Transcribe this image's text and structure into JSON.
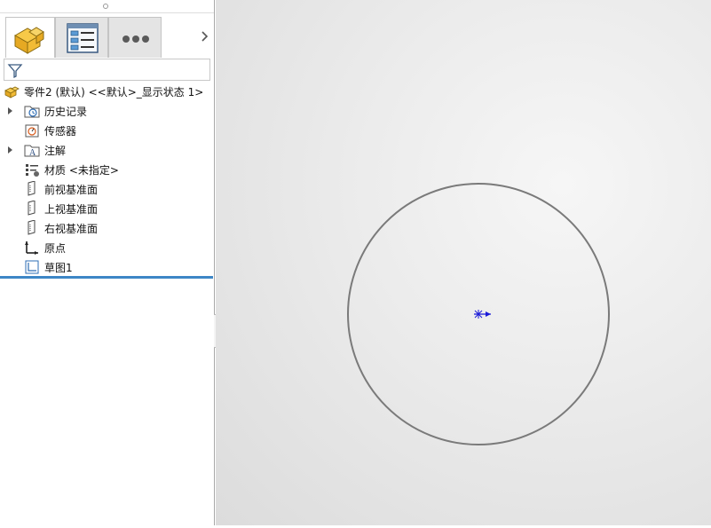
{
  "feature_manager": {
    "tabs": [
      {
        "name": "FeatureManager design tree",
        "icon": "part-feature-icon"
      },
      {
        "name": "PropertyManager",
        "icon": "property-manager-icon"
      },
      {
        "name": "More",
        "icon": "more-dots-icon"
      }
    ],
    "filter": {
      "icon": "filter-icon",
      "value": ""
    },
    "root": {
      "label": "零件2 (默认) <<默认>_显示状态 1>",
      "icon": "part-icon"
    },
    "items": [
      {
        "label": "历史记录",
        "icon": "history-folder-icon",
        "expandable": true
      },
      {
        "label": "传感器",
        "icon": "sensor-icon",
        "expandable": false
      },
      {
        "label": "注解",
        "icon": "annotation-icon",
        "expandable": true
      },
      {
        "label": "材质 <未指定>",
        "icon": "material-icon",
        "expandable": false
      },
      {
        "label": "前视基准面",
        "icon": "plane-icon",
        "expandable": false
      },
      {
        "label": "上视基准面",
        "icon": "plane-icon",
        "expandable": false
      },
      {
        "label": "右视基准面",
        "icon": "plane-icon",
        "expandable": false
      },
      {
        "label": "原点",
        "icon": "origin-icon",
        "expandable": false
      },
      {
        "label": "草图1",
        "icon": "sketch-icon",
        "expandable": false
      }
    ]
  },
  "colors": {
    "rollback_bar": "#3d86c6",
    "circle": "#7a7a7a",
    "origin": "#1a1ad8"
  },
  "viewport": {
    "sketch_entities": [
      "circle",
      "origin-marker"
    ]
  }
}
